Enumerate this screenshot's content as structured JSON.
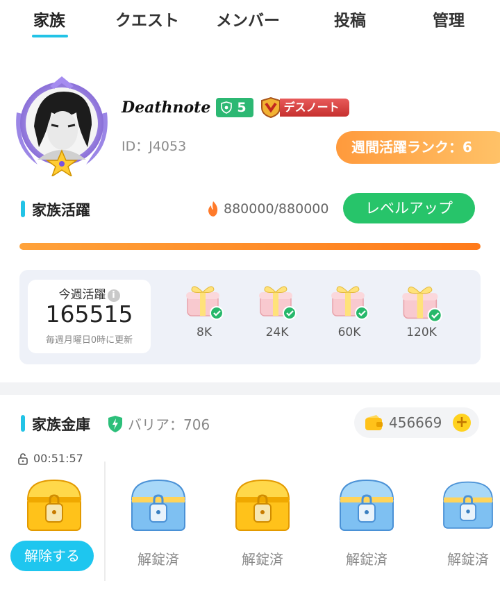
{
  "tabs": [
    {
      "label": "家族",
      "active": true
    },
    {
      "label": "クエスト"
    },
    {
      "label": "メンバー"
    },
    {
      "label": "投稿"
    },
    {
      "label": "管理"
    }
  ],
  "profile": {
    "name": "Deathnote",
    "level": "5",
    "title_badge": "デスノート",
    "id_text": "ID：J4053",
    "weekly_rank": "週間活躍ランク：6"
  },
  "activity": {
    "title": "家族活躍",
    "count": "880000/880000",
    "progress": 1.0,
    "levelup_label": "レベルアップ",
    "weekly_label": "今週活躍",
    "weekly_info_icon": "i",
    "weekly_value": "165515",
    "weekly_note": "毎週月曜日0時に更新",
    "gifts": [
      {
        "label": "8K",
        "claimed": true
      },
      {
        "label": "24K",
        "claimed": true
      },
      {
        "label": "60K",
        "claimed": true
      },
      {
        "label": "120K",
        "claimed": true
      }
    ]
  },
  "vault": {
    "title": "家族金庫",
    "barrier": "バリア：706",
    "coins": "456669",
    "plus": "+",
    "timer": "00:51:57",
    "unlock_label": "解除する",
    "chests": [
      {
        "kind": "gold",
        "label": ""
      },
      {
        "kind": "blue",
        "label": "解錠済"
      },
      {
        "kind": "gold",
        "label": "解錠済"
      },
      {
        "kind": "blue",
        "label": "解錠済"
      },
      {
        "kind": "blue",
        "label": "解錠済"
      }
    ]
  },
  "colors": {
    "accent": "#22c3e6",
    "green": "#27c46a",
    "orange": "#ff8a2a",
    "gold": "#ffc21a"
  }
}
